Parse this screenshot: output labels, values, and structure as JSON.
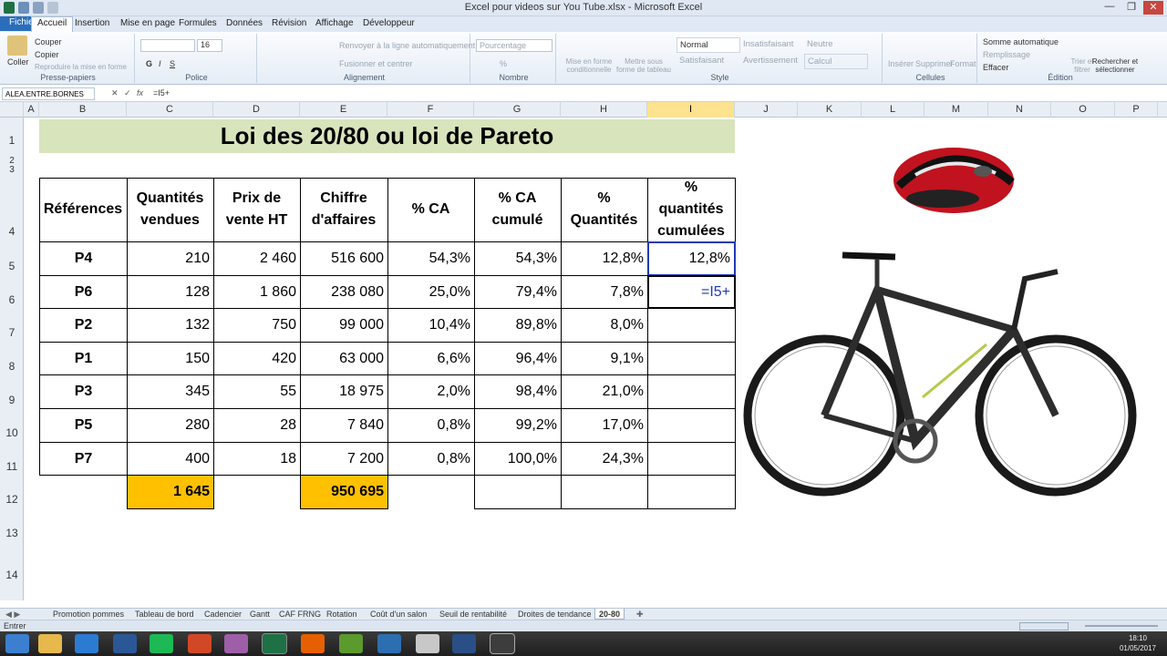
{
  "window": {
    "title": "Excel pour videos sur You Tube.xlsx - Microsoft Excel"
  },
  "ribbon_tabs": [
    "Fichier",
    "Accueil",
    "Insertion",
    "Mise en page",
    "Formules",
    "Données",
    "Révision",
    "Affichage",
    "Développeur"
  ],
  "ribbon": {
    "clipboard": {
      "paste": "Coller",
      "cut": "Couper",
      "copy": "Copier",
      "format_painter": "Reproduire la mise en forme",
      "label": "Presse-papiers"
    },
    "font": {
      "size": "16",
      "label": "Police"
    },
    "alignment": {
      "wrap": "Renvoyer à la ligne automatiquement",
      "merge": "Fusionner et centrer",
      "label": "Alignement"
    },
    "number": {
      "format": "Pourcentage",
      "label": "Nombre"
    },
    "styles": {
      "conditional": "Mise en forme conditionnelle",
      "table": "Mettre sous forme de tableau",
      "normal": "Normal",
      "insuffisant": "Insatisfaisant",
      "neutre": "Neutre",
      "satisfaisant": "Satisfaisant",
      "avertissement": "Avertissement",
      "calcul": "Calcul",
      "label": "Style"
    },
    "cells": {
      "insert": "Insérer",
      "delete": "Supprimer",
      "format": "Format",
      "label": "Cellules"
    },
    "editing": {
      "autosum": "Somme automatique",
      "fill": "Remplissage",
      "clear": "Effacer",
      "sort": "Trier et filtrer",
      "find": "Rechercher et sélectionner",
      "label": "Édition"
    }
  },
  "formula_bar": {
    "name_box": "ALEA.ENTRE.BORNES",
    "fx": "fx",
    "formula": "=I5+"
  },
  "columns": [
    "A",
    "B",
    "C",
    "D",
    "E",
    "F",
    "G",
    "H",
    "I",
    "J",
    "K",
    "L",
    "M",
    "N",
    "O",
    "P"
  ],
  "rows": [
    "1",
    "2",
    "3",
    "4",
    "5",
    "6",
    "7",
    "8",
    "9",
    "10",
    "11",
    "12",
    "13",
    "14"
  ],
  "sheet": {
    "title": "Loi des 20/80 ou loi de Pareto",
    "headers": [
      "Références",
      "Quantités vendues",
      "Prix de vente HT",
      "Chiffre d'affaires",
      "% CA",
      "% CA cumulé",
      "% Quantités",
      "% quantités cumulées"
    ],
    "data": [
      [
        "P4",
        "210",
        "2 460",
        "516 600",
        "54,3%",
        "54,3%",
        "12,8%",
        "12,8%"
      ],
      [
        "P6",
        "128",
        "1 860",
        "238 080",
        "25,0%",
        "79,4%",
        "7,8%",
        "=I5+"
      ],
      [
        "P2",
        "132",
        "750",
        "99 000",
        "10,4%",
        "89,8%",
        "8,0%",
        ""
      ],
      [
        "P1",
        "150",
        "420",
        "63 000",
        "6,6%",
        "96,4%",
        "9,1%",
        ""
      ],
      [
        "P3",
        "345",
        "55",
        "18 975",
        "2,0%",
        "98,4%",
        "21,0%",
        ""
      ],
      [
        "P5",
        "280",
        "28",
        "7 840",
        "0,8%",
        "99,2%",
        "17,0%",
        ""
      ],
      [
        "P7",
        "400",
        "18",
        "7 200",
        "0,8%",
        "100,0%",
        "24,3%",
        ""
      ]
    ],
    "totals": {
      "quantity": "1 645",
      "revenue": "950 695"
    }
  },
  "sheet_tabs": [
    "Promotion pommes",
    "Tableau de bord",
    "Cadencier",
    "Gantt",
    "CAF FRNG",
    "Rotation",
    "Coût d'un salon",
    "Seuil de rentabilité",
    "Droites de tendance",
    "20-80"
  ],
  "status": {
    "mode": "Entrer"
  },
  "clock": {
    "time": "18:10",
    "date": "01/05/2017"
  },
  "colors": {
    "title_fill": "#d8e4bc",
    "total_fill": "#ffc000",
    "formula_ref": "#1f3ab5",
    "accent": "#2a6ebb"
  }
}
